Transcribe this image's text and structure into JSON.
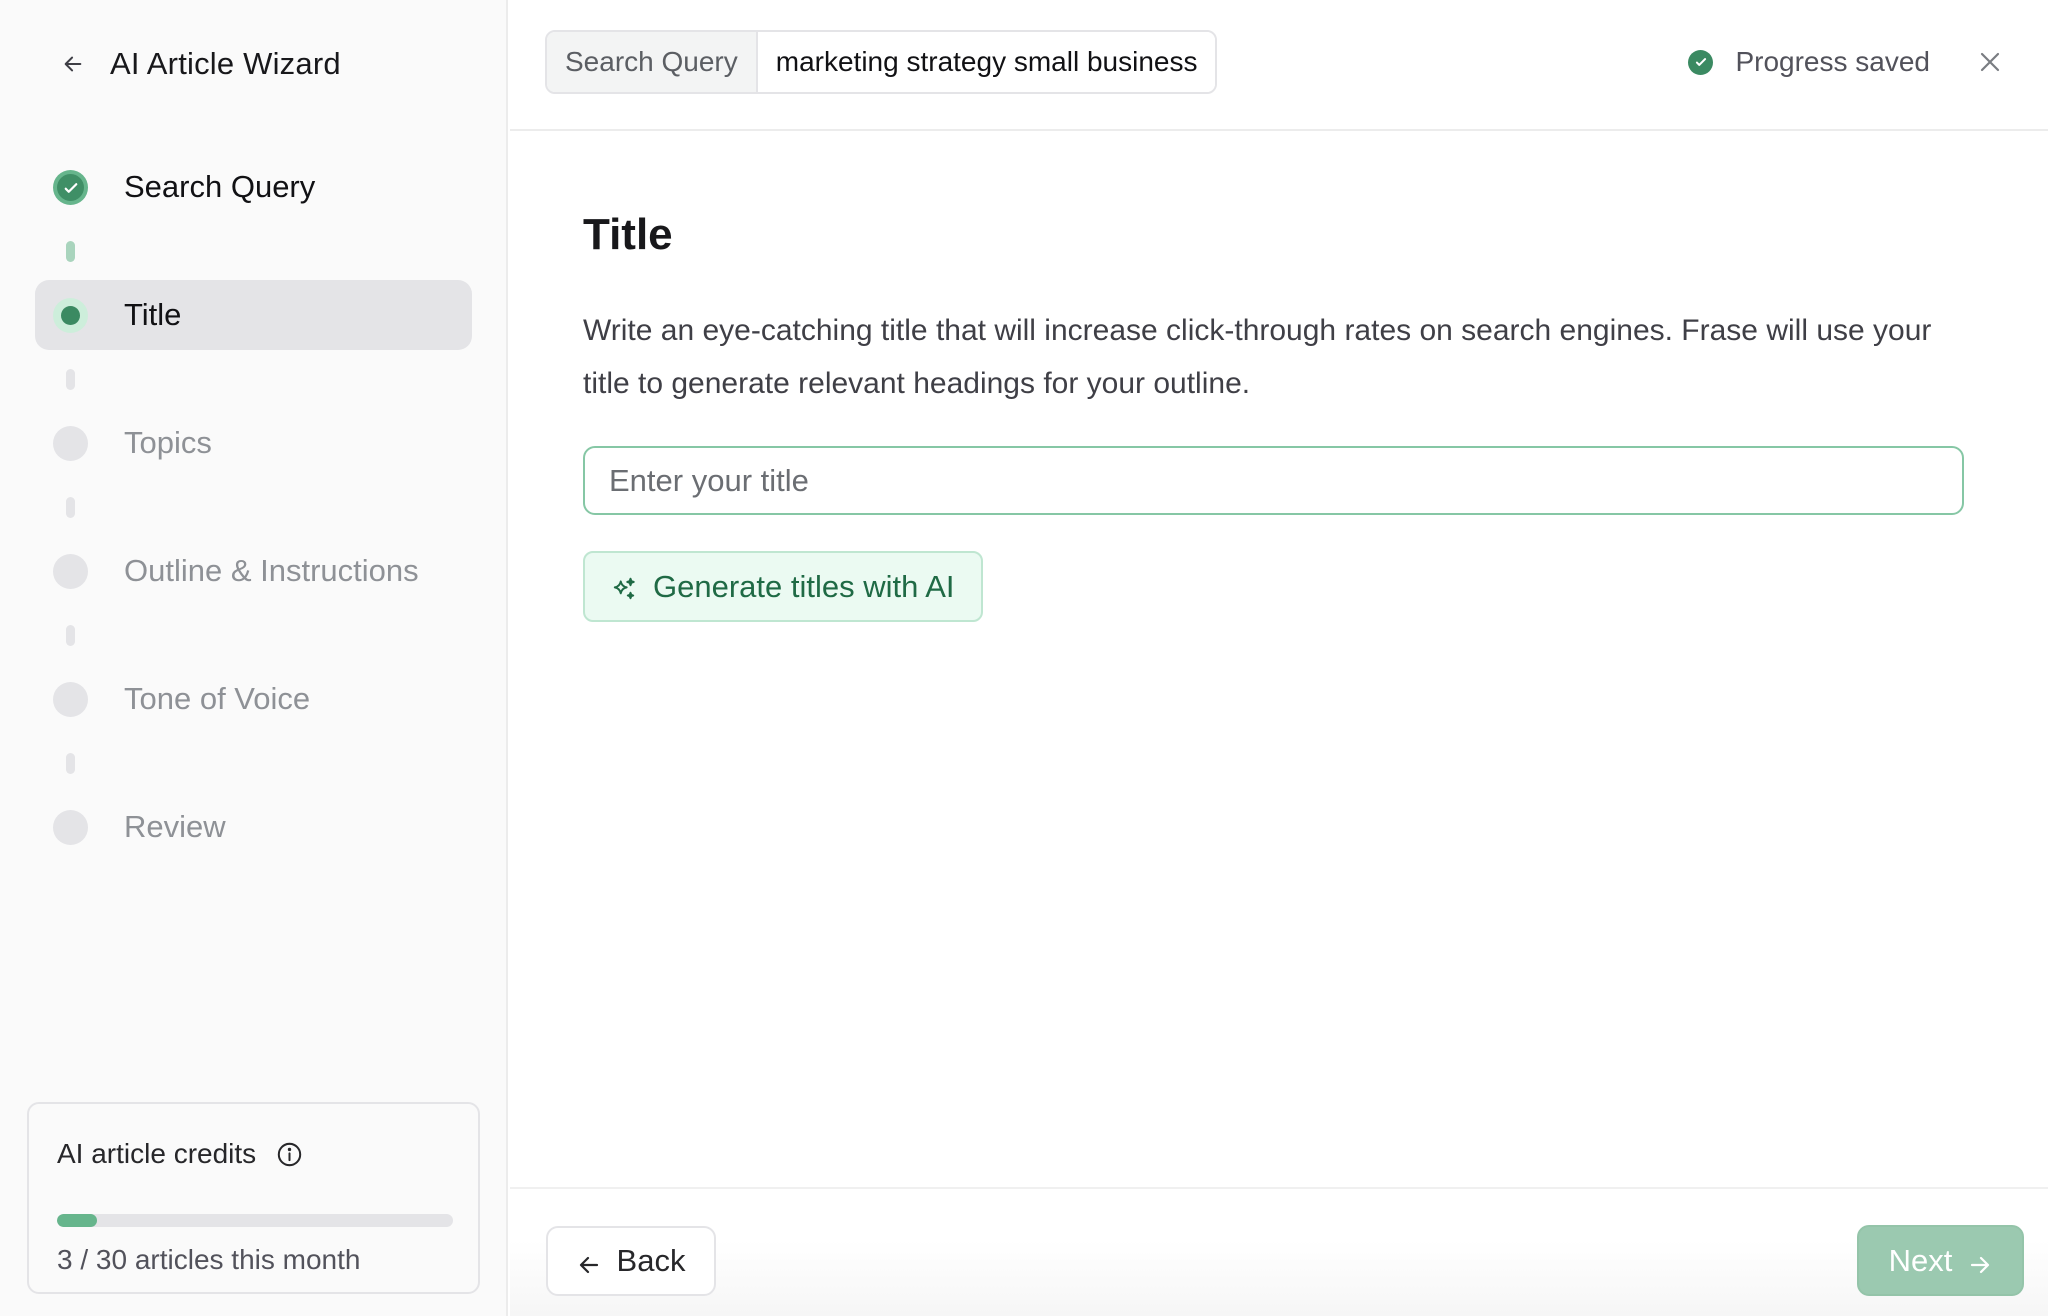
{
  "sidebar": {
    "title": "AI Article Wizard",
    "back_icon": "arrow-left-icon",
    "steps": [
      {
        "label": "Search Query",
        "status": "done"
      },
      {
        "label": "Title",
        "status": "current"
      },
      {
        "label": "Topics",
        "status": "pending"
      },
      {
        "label": "Outline & Instructions",
        "status": "pending"
      },
      {
        "label": "Tone of Voice",
        "status": "pending"
      },
      {
        "label": "Review",
        "status": "pending"
      }
    ],
    "credits": {
      "title": "AI article credits",
      "used": 3,
      "total": 30,
      "progress_fraction": 0.1,
      "summary": "3 / 30 articles this month"
    }
  },
  "header": {
    "search_query_label": "Search Query",
    "search_query_value": "marketing strategy small business",
    "status_text": "Progress saved",
    "close_icon": "close-icon"
  },
  "main": {
    "heading": "Title",
    "description": "Write an eye-catching title that will increase click-through rates on search engines. Frase will use your title to generate relevant headings for your outline.",
    "title_input": {
      "value": "",
      "placeholder": "Enter your title"
    },
    "generate_button": "Generate titles with AI"
  },
  "footer": {
    "back_label": "Back",
    "next_label": "Next"
  },
  "colors": {
    "accent": "#3b8a62",
    "accent_light": "#ebfaf2",
    "next_disabled": "#9bc9b0"
  }
}
